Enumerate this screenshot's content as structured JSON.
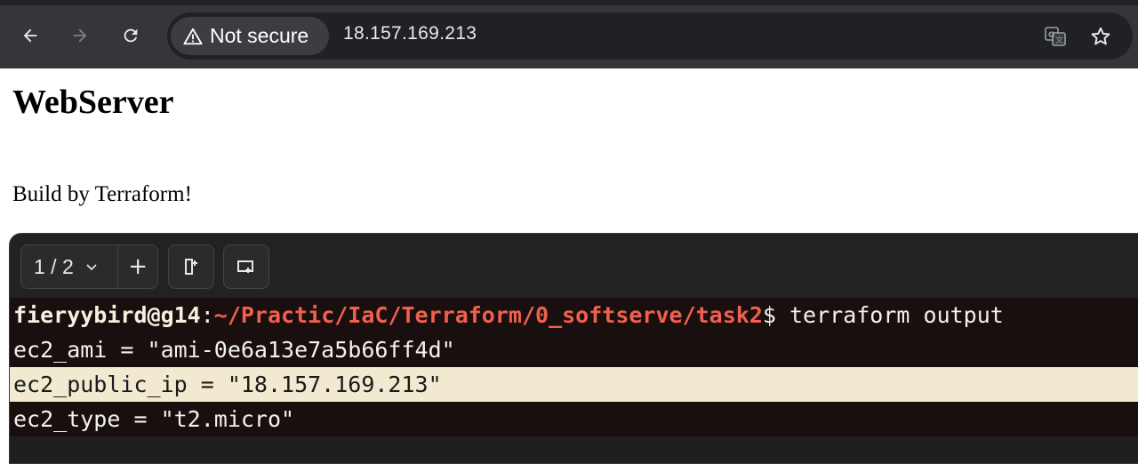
{
  "browser": {
    "security_label": "Not secure",
    "url": "18.157.169.213",
    "icons": [
      "back-arrow-icon",
      "forward-arrow-icon",
      "reload-icon",
      "warning-icon",
      "translate-icon",
      "star-icon"
    ]
  },
  "page": {
    "heading": "WebServer",
    "text": "Build by Terraform!"
  },
  "terminal": {
    "tab_counter": "1 / 2",
    "add_tab": "+",
    "prompt": {
      "user_host": "fieryybird@g14",
      "separator": ":",
      "path": "~/Practic/IaC/Terraform/0_softserve/task2",
      "symbol": "$",
      "command": " terraform output"
    },
    "output_lines": [
      "ec2_ami = \"ami-0e6a13e7a5b66ff4d\"",
      "ec2_public_ip = \"18.157.169.213\"",
      "ec2_type = \"t2.micro\""
    ],
    "colors": {
      "path": "#f0604e",
      "highlight": "#f1ead0",
      "background": "#1a0f0f"
    }
  }
}
